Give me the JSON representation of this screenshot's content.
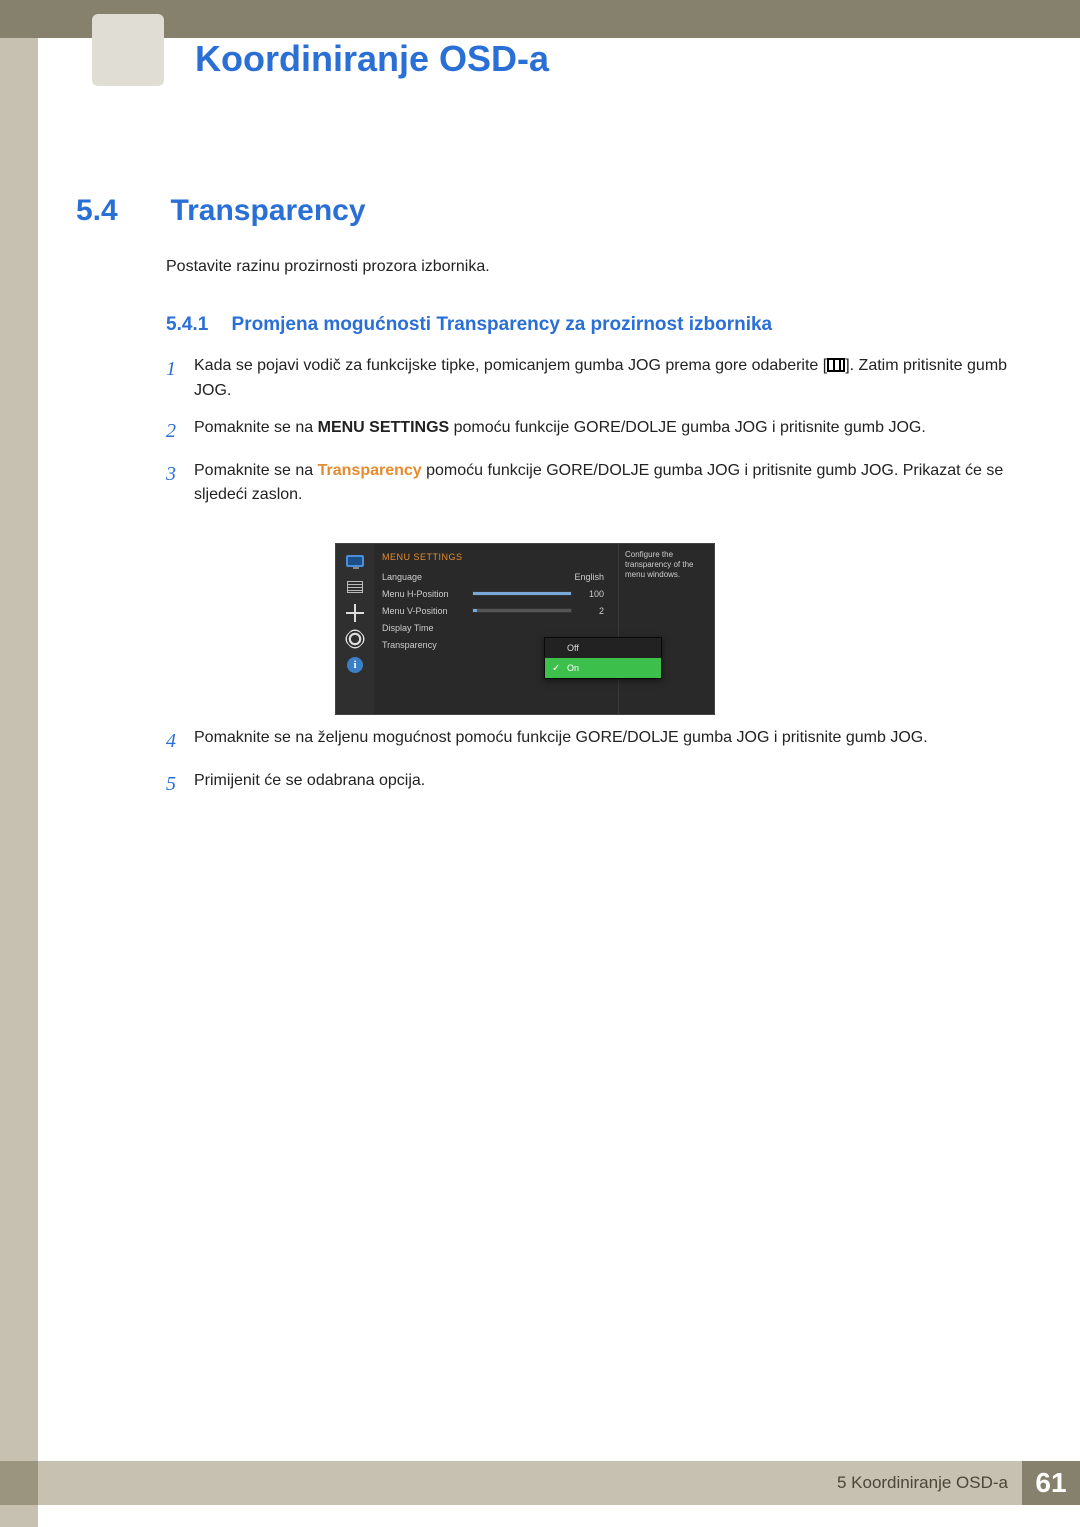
{
  "header": {
    "chapter_title": "Koordiniranje OSD-a"
  },
  "section": {
    "number": "5.4",
    "title": "Transparency"
  },
  "intro": "Postavite razinu prozirnosti prozora izbornika.",
  "subsection": {
    "number": "5.4.1",
    "title": "Promjena mogućnosti Transparency za prozirnost izbornika"
  },
  "steps_a": [
    {
      "n": "1",
      "pre": "Kada se pojavi vodič za funkcijske tipke, pomicanjem gumba JOG prema gore odaberite [",
      "post": "]. Zatim pritisnite gumb JOG."
    },
    {
      "n": "2",
      "pre": "Pomaknite se na ",
      "bold": "MENU SETTINGS",
      "post": " pomoću funkcije GORE/DOLJE gumba JOG i pritisnite gumb JOG."
    },
    {
      "n": "3",
      "pre": "Pomaknite se na ",
      "orange": "Transparency",
      "post": " pomoću funkcije GORE/DOLJE gumba JOG i pritisnite gumb JOG. Prikazat će se sljedeći zaslon."
    }
  ],
  "osd": {
    "header": "MENU SETTINGS",
    "tooltip": "Configure the transparency of the menu windows.",
    "rows": {
      "language": {
        "label": "Language",
        "value": "English"
      },
      "hpos": {
        "label": "Menu H-Position",
        "value": "100",
        "fill": "100%"
      },
      "vpos": {
        "label": "Menu V-Position",
        "value": "2",
        "fill": "4%"
      },
      "dtime": {
        "label": "Display Time"
      },
      "trans": {
        "label": "Transparency"
      }
    },
    "dropdown": {
      "off": "Off",
      "on": "On"
    }
  },
  "steps_b": [
    {
      "n": "4",
      "text": "Pomaknite se na željenu mogućnost pomoću funkcije GORE/DOLJE gumba JOG i pritisnite gumb JOG."
    },
    {
      "n": "5",
      "text": "Primijenit će se odabrana opcija."
    }
  ],
  "footer": {
    "label": "5 Koordiniranje OSD-a",
    "page": "61"
  }
}
